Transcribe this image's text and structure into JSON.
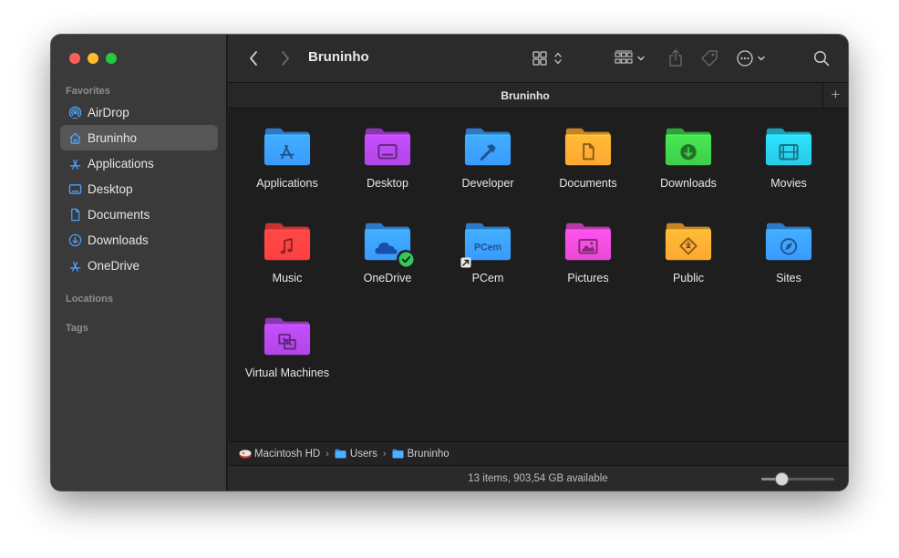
{
  "colors": {
    "close": "#ff5f57",
    "minimize": "#febc2e",
    "zoom": "#28c840",
    "accent": "#3a9bff"
  },
  "sidebar": {
    "favorites_title": "Favorites",
    "items": [
      {
        "label": "AirDrop",
        "icon": "airdrop-icon"
      },
      {
        "label": "Bruninho",
        "icon": "home-icon",
        "active": true
      },
      {
        "label": "Applications",
        "icon": "applications-icon"
      },
      {
        "label": "Desktop",
        "icon": "desktop-icon"
      },
      {
        "label": "Documents",
        "icon": "document-icon"
      },
      {
        "label": "Downloads",
        "icon": "download-icon"
      },
      {
        "label": "OneDrive",
        "icon": "applications-icon"
      }
    ],
    "locations_title": "Locations",
    "tags_title": "Tags"
  },
  "toolbar": {
    "title": "Bruninho",
    "icons": [
      "back-icon",
      "forward-icon",
      "grid-view-icon",
      "group-icon",
      "share-icon",
      "tag-icon",
      "more-icon",
      "search-icon"
    ]
  },
  "tab": {
    "label": "Bruninho",
    "plus": "+"
  },
  "items": [
    {
      "name": "Applications",
      "color": "#3a9bff",
      "glyph": "A"
    },
    {
      "name": "Desktop",
      "color": "#b146e6",
      "glyph": "desktop"
    },
    {
      "name": "Developer",
      "color": "#3a9bff",
      "glyph": "hammer"
    },
    {
      "name": "Documents",
      "color": "#ffa830",
      "glyph": "doc"
    },
    {
      "name": "Downloads",
      "color": "#3fcf4a",
      "glyph": "down"
    },
    {
      "name": "Movies",
      "color": "#27cbe8",
      "glyph": "film"
    },
    {
      "name": "Music",
      "color": "#ff4040",
      "glyph": "note"
    },
    {
      "name": "OneDrive",
      "color": "#3a9bff",
      "glyph": "cloud"
    },
    {
      "name": "PCem",
      "color": "#3a9bff",
      "glyph": "text",
      "label": "PCem"
    },
    {
      "name": "Pictures",
      "color": "#e94ad5",
      "glyph": "picture"
    },
    {
      "name": "Public",
      "color": "#ffa830",
      "glyph": "public"
    },
    {
      "name": "Sites",
      "color": "#3a9bff",
      "glyph": "compass"
    },
    {
      "name": "Virtual Machines",
      "color": "#b146e6",
      "glyph": "vm"
    }
  ],
  "pathbar": [
    {
      "label": "Macintosh HD",
      "icon": "disk-icon"
    },
    {
      "label": "Users",
      "icon": "folder-icon"
    },
    {
      "label": "Bruninho",
      "icon": "folder-icon"
    }
  ],
  "pathbar_sep": "›",
  "status": {
    "text": "13 items, 903,54 GB available"
  },
  "zoom_slider": {
    "value": 0.23
  }
}
